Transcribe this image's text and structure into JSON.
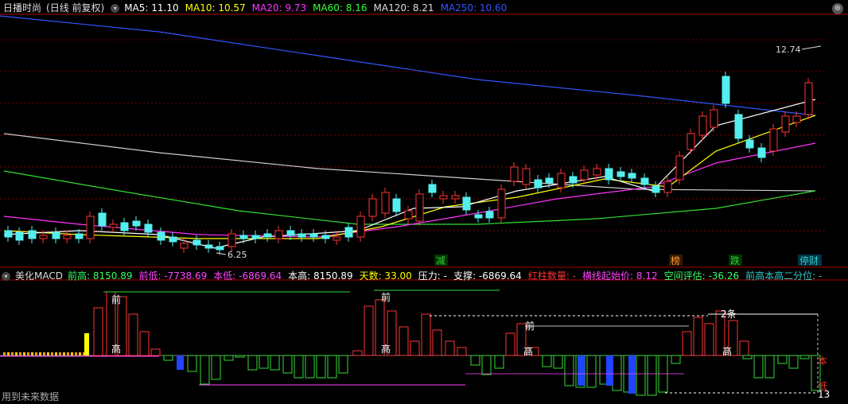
{
  "price_panel": {
    "stock_title": "日播时尚",
    "mode": "(日线 前复权)",
    "ma": [
      {
        "label": "MA5: 11.10",
        "color": "#ffffff"
      },
      {
        "label": "MA10: 10.57",
        "color": "#ffff00"
      },
      {
        "label": "MA20: 9.73",
        "color": "#ff33ff"
      },
      {
        "label": "MA60: 8.16",
        "color": "#33ff33"
      },
      {
        "label": "MA120: 8.21",
        "color": "#dddddd"
      },
      {
        "label": "MA250: 10.60",
        "color": "#3355ff"
      }
    ],
    "high_label": "12.74",
    "low_label": "6.25",
    "event_tags": [
      "减",
      "榜",
      "跌",
      "停财"
    ]
  },
  "macd_panel": {
    "title": "美化MACD",
    "fields": [
      {
        "label": "前高: 8150.89",
        "color": "#33ff66"
      },
      {
        "label": "前低: -7738.69",
        "color": "#ff44ff"
      },
      {
        "label": "本低: -6869.64",
        "color": "#ff44ff"
      },
      {
        "label": "本高: 8150.89",
        "color": "#ffffff"
      },
      {
        "label": "天数: 33.00",
        "color": "#ffff00"
      },
      {
        "label": "压力: -",
        "color": "#ffffff"
      },
      {
        "label": "支撑: -6869.64",
        "color": "#ffffff"
      },
      {
        "label": "红柱数量: -",
        "color": "#ff3333"
      },
      {
        "label": "横线起始价: 8.12",
        "color": "#ff44ff"
      },
      {
        "label": "空间评估: -36.26",
        "color": "#33ff66"
      },
      {
        "label": "前高本高二分位: -",
        "color": "#33cccc"
      }
    ],
    "annotations": {
      "qian": "前",
      "gao": "高",
      "ben": "本",
      "di": "低",
      "count": "13",
      "mark": "2条"
    }
  },
  "footer": {
    "text": "用到未来数据"
  }
}
